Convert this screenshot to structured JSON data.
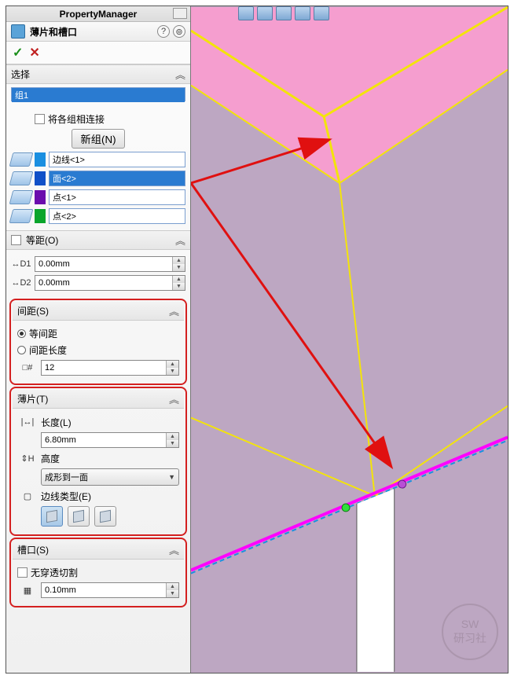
{
  "title": "PropertyManager",
  "feature_name": "薄片和槽口",
  "sections": {
    "select": {
      "label": "选择",
      "group_item": "组1",
      "connect_groups": "将各组相连接",
      "new_group_btn": "新组(N)",
      "items": [
        {
          "swatch": "azure",
          "text": "边线<1>",
          "selected": false
        },
        {
          "swatch": "blue",
          "text": "面<2>",
          "selected": true
        },
        {
          "swatch": "purple",
          "text": "点<1>",
          "selected": false
        },
        {
          "swatch": "green",
          "text": "点<2>",
          "selected": false
        }
      ]
    },
    "offset": {
      "label": "等距(O)",
      "d1": "0.00mm",
      "d2": "0.00mm"
    },
    "spacing": {
      "label": "间距(S)",
      "r1": "等间距",
      "r2": "间距长度",
      "count": "12"
    },
    "tab": {
      "label": "薄片(T)",
      "length_label": "长度(L)",
      "length_val": "6.80mm",
      "height_label": "高度",
      "height_combo": "成形到一面",
      "edge_type": "边线类型(E)"
    },
    "slot": {
      "label": "槽口(S)",
      "through": "无穿透切割",
      "val": "0.10mm",
      "val2": "0.10mm"
    }
  },
  "watermark": {
    "l1": "SW",
    "l2": "研习社"
  }
}
